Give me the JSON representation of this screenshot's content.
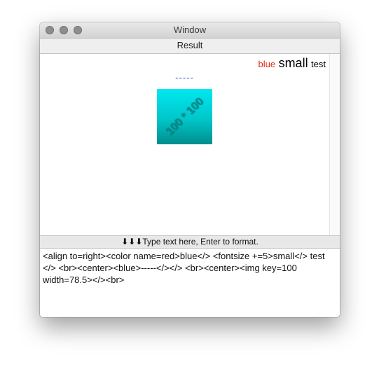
{
  "window": {
    "title": "Window"
  },
  "header": {
    "title": "Result"
  },
  "result": {
    "word_blue": "blue",
    "word_small": "small",
    "word_test": "test",
    "dashes": "-----",
    "image_label": "100 * 100"
  },
  "hint": {
    "arrows": "⬇⬇⬇",
    "text": "Type text here, Enter to format."
  },
  "editor": {
    "value": "<align to=right><color name=red>blue</> <fontsize +=5>small</> test </> <br><center><blue>-----</></> <br><center><img key=100 width=78.5></><br>"
  },
  "colors": {
    "red_text": "#e02a14",
    "blue_text": "#3343d8",
    "image_fill": "#00d8de"
  }
}
